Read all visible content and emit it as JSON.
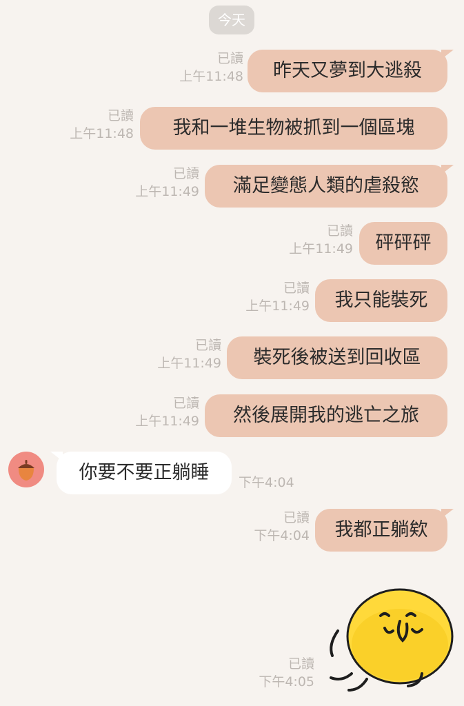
{
  "date_separator": "今天",
  "messages": [
    {
      "text": "昨天又夢到大逃殺",
      "read": "已讀",
      "time": "上午11:48"
    },
    {
      "text": "我和一堆生物被抓到一個區塊",
      "read": "已讀",
      "time": "上午11:48"
    },
    {
      "text": "滿足變態人類的虐殺慾",
      "read": "已讀",
      "time": "上午11:49"
    },
    {
      "text": "砰砰砰",
      "read": "已讀",
      "time": "上午11:49"
    },
    {
      "text": "我只能裝死",
      "read": "已讀",
      "time": "上午11:49"
    },
    {
      "text": "裝死後被送到回收區",
      "read": "已讀",
      "time": "上午11:49"
    },
    {
      "text": "然後展開我的逃亡之旅",
      "read": "已讀",
      "time": "上午11:49"
    },
    {
      "text": "你要不要正躺睡",
      "time": "下午4:04"
    },
    {
      "text": "我都正躺欸",
      "read": "已讀",
      "time": "下午4:04"
    },
    {
      "read": "已讀",
      "time": "下午4:05",
      "sticker": "yellow-blob-sticker"
    }
  ],
  "colors": {
    "background": "#f7f3ef",
    "outgoing_bubble": "#ecc6b2",
    "incoming_bubble": "#ffffff",
    "meta_text": "#bdb7b2"
  },
  "icons": {
    "avatar": "acorn-avatar-icon"
  }
}
